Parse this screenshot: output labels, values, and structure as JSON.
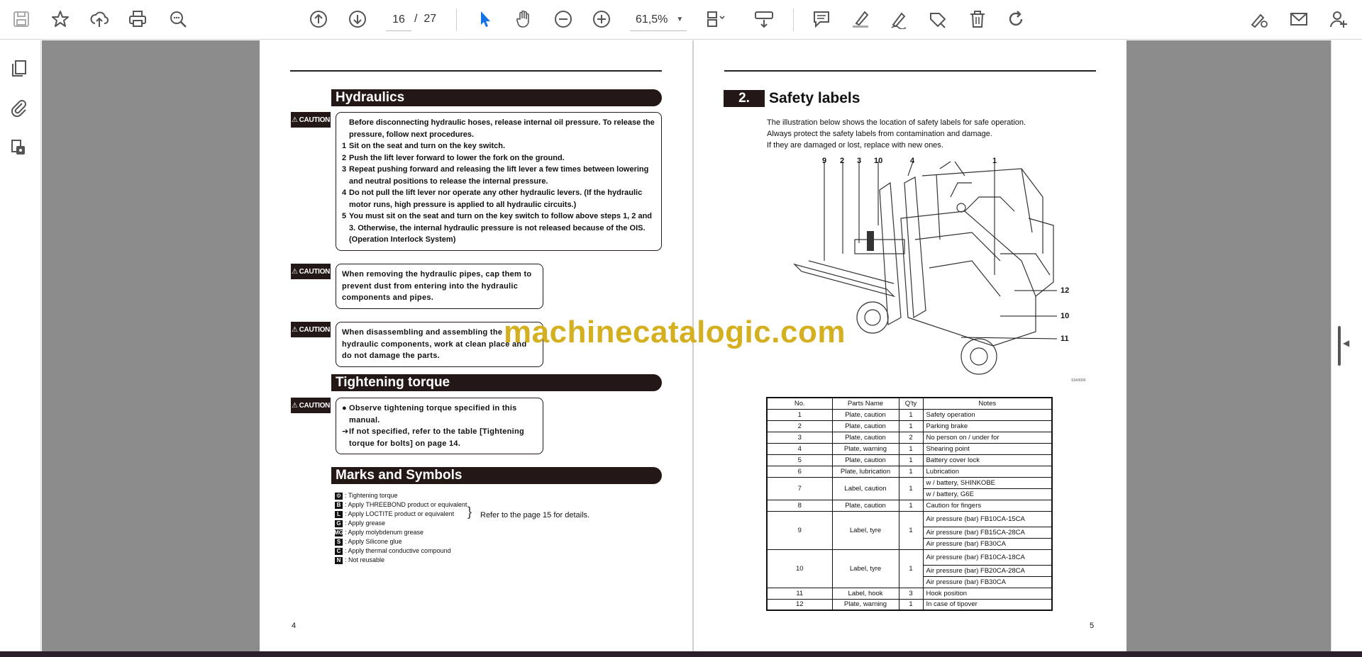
{
  "toolbar": {
    "current_page": "16",
    "page_separator": "/",
    "total_pages": "27",
    "zoom": "61,5%"
  },
  "left_page": {
    "sections": {
      "hydraulics": "Hydraulics",
      "tightening": "Tightening torque",
      "marks": "Marks and Symbols"
    },
    "caution_label": "CAUTION",
    "caution1": {
      "intro": "Before disconnecting hydraulic hoses, release internal oil pressure. To release the pressure, follow next procedures.",
      "steps": [
        {
          "n": "1",
          "text": "Sit on the seat and turn on the key switch."
        },
        {
          "n": "2",
          "text": "Push the lift lever forward to lower the fork on the ground."
        },
        {
          "n": "3",
          "text": "Repeat pushing forward and releasing the lift lever a few times between lowering and neutral positions to release the internal pressure."
        },
        {
          "n": "4",
          "text": "Do not pull the lift lever nor operate any other hydraulic levers. (If the hydraulic motor runs, high pressure is applied to all hydraulic circuits.)"
        },
        {
          "n": "5",
          "text": "You must sit on the seat and turn on the key switch to follow above steps 1, 2 and 3. Otherwise, the internal hydraulic pressure is not released because of the OIS. (Operation Interlock System)"
        }
      ]
    },
    "caution2": "When removing the hydraulic pipes, cap them to prevent dust from entering into the hydraulic components and pipes.",
    "caution3": "When disassembling and assembling the hydraulic components, work at clean place and do not damage the parts.",
    "caution4": {
      "line1": "Observe tightening torque specified in this manual.",
      "line2": "If not specified, refer to the table [Tightening torque for bolts] on page 14."
    },
    "marks": [
      {
        "sym": "⚙",
        "text": ": Tightening torque"
      },
      {
        "sym": "B",
        "text": ": Apply THREEBOND product or equivalent"
      },
      {
        "sym": "L",
        "text": ": Apply LOCTITE product or equivalent"
      },
      {
        "sym": "G",
        "text": ": Apply grease"
      },
      {
        "sym": "MG",
        "text": ": Apply molybdenum grease"
      },
      {
        "sym": "S",
        "text": ": Apply Silicone glue"
      },
      {
        "sym": "C",
        "text": ": Apply thermal conductive compound"
      },
      {
        "sym": "N",
        "text": ": Not reusable"
      }
    ],
    "marks_note": "Refer to the page 15 for details.",
    "page_number": "4"
  },
  "right_page": {
    "section_number": "2.",
    "section_title": "Safety labels",
    "intro_lines": [
      "The illustration below shows the location of safety labels for safe operation.",
      "Always protect the safety labels from contamination and damage.",
      "If they are damaged or lost, replace with new ones."
    ],
    "callouts_top": [
      "9",
      "2",
      "3",
      "10",
      "4",
      "1"
    ],
    "callouts_side": [
      "12",
      "10",
      "11"
    ],
    "table_headers": [
      "No.",
      "Parts Name",
      "Q'ty",
      "Notes"
    ],
    "table_rows": [
      {
        "no": "1",
        "part": "Plate, caution",
        "qty": "1",
        "notes": [
          "Safety operation"
        ]
      },
      {
        "no": "2",
        "part": "Plate, caution",
        "qty": "1",
        "notes": [
          "Parking brake"
        ]
      },
      {
        "no": "3",
        "part": "Plate, caution",
        "qty": "2",
        "notes": [
          "No person on / under for"
        ]
      },
      {
        "no": "4",
        "part": "Plate, warning",
        "qty": "1",
        "notes": [
          "Shearing point"
        ]
      },
      {
        "no": "5",
        "part": "Plate, caution",
        "qty": "1",
        "notes": [
          "Battery cover lock"
        ]
      },
      {
        "no": "6",
        "part": "Plate, lubrication",
        "qty": "1",
        "notes": [
          "Lubrication"
        ]
      },
      {
        "no": "7",
        "part": "Label, caution",
        "qty": "1",
        "notes": [
          "w / battery, SHINKOBE",
          "w / battery, G6E"
        ]
      },
      {
        "no": "8",
        "part": "Plate, caution",
        "qty": "1",
        "notes": [
          "Caution for fingers"
        ]
      },
      {
        "no": "9",
        "part": "Label, tyre",
        "qty": "1",
        "notes": [
          "Air pressure (bar) FB10CA-15CA",
          "Air pressure (bar) FB15CA-28CA",
          "Air pressure (bar) FB30CA"
        ]
      },
      {
        "no": "10",
        "part": "Label, tyre",
        "qty": "1",
        "notes": [
          "Air pressure (bar) FB10CA-18CA",
          "Air pressure (bar) FB20CA-28CA",
          "Air pressure (bar) FB30CA"
        ]
      },
      {
        "no": "11",
        "part": "Label, hook",
        "qty": "3",
        "notes": [
          "Hook position"
        ]
      },
      {
        "no": "12",
        "part": "Plate, warning",
        "qty": "1",
        "notes": [
          "In case of tipover"
        ]
      }
    ],
    "page_number": "5"
  },
  "watermark": "machinecatalogic.com",
  "icons": {
    "save": "save-icon",
    "bookmark": "star-icon",
    "upload": "cloud-upload-icon",
    "print": "print-icon",
    "zoom": "zoom-icon",
    "prev": "arrow-up-icon",
    "next": "arrow-down-icon",
    "select": "cursor-icon",
    "hand": "hand-icon",
    "zoom_out": "minus-icon",
    "zoom_in": "plus-icon"
  }
}
